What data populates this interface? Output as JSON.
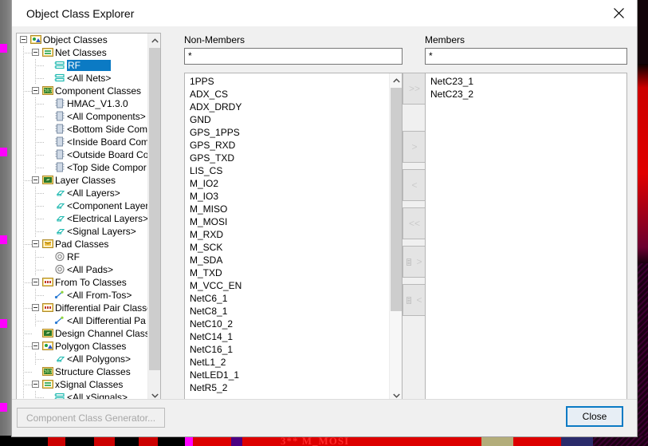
{
  "window": {
    "title": "Object Class Explorer",
    "close_icon": "close-icon"
  },
  "tree": {
    "items": [
      {
        "label": "Object Classes",
        "depth": 0,
        "icon": "object-classes-icon",
        "expander": "minus",
        "selected": false
      },
      {
        "label": "Net Classes",
        "depth": 1,
        "icon": "net-class-folder-icon",
        "expander": "minus",
        "selected": false
      },
      {
        "label": "RF",
        "depth": 2,
        "icon": "net-class-icon",
        "expander": "none",
        "selected": true
      },
      {
        "label": "<All Nets>",
        "depth": 2,
        "icon": "net-class-icon",
        "expander": "none",
        "selected": false
      },
      {
        "label": "Component Classes",
        "depth": 1,
        "icon": "component-folder-icon",
        "expander": "minus",
        "selected": false
      },
      {
        "label": "HMAC_V1.3.0",
        "depth": 2,
        "icon": "component-icon",
        "expander": "none",
        "selected": false
      },
      {
        "label": "<All Components>",
        "depth": 2,
        "icon": "component-icon",
        "expander": "none",
        "selected": false
      },
      {
        "label": "<Bottom Side Com",
        "depth": 2,
        "icon": "component-icon",
        "expander": "none",
        "selected": false
      },
      {
        "label": "<Inside Board Com",
        "depth": 2,
        "icon": "component-icon",
        "expander": "none",
        "selected": false
      },
      {
        "label": "<Outside Board Co",
        "depth": 2,
        "icon": "component-icon",
        "expander": "none",
        "selected": false
      },
      {
        "label": "<Top Side Compor",
        "depth": 2,
        "icon": "component-icon",
        "expander": "none",
        "selected": false
      },
      {
        "label": "Layer Classes",
        "depth": 1,
        "icon": "layer-folder-icon",
        "expander": "minus",
        "selected": false
      },
      {
        "label": "<All Layers>",
        "depth": 2,
        "icon": "layer-icon",
        "expander": "none",
        "selected": false
      },
      {
        "label": "<Component Layer",
        "depth": 2,
        "icon": "layer-icon",
        "expander": "none",
        "selected": false
      },
      {
        "label": "<Electrical Layers>",
        "depth": 2,
        "icon": "layer-icon",
        "expander": "none",
        "selected": false
      },
      {
        "label": "<Signal Layers>",
        "depth": 2,
        "icon": "layer-icon",
        "expander": "none",
        "selected": false
      },
      {
        "label": "Pad Classes",
        "depth": 1,
        "icon": "pad-folder-icon",
        "expander": "minus",
        "selected": false
      },
      {
        "label": "RF",
        "depth": 2,
        "icon": "pad-icon",
        "expander": "none",
        "selected": false
      },
      {
        "label": "<All Pads>",
        "depth": 2,
        "icon": "pad-icon",
        "expander": "none",
        "selected": false
      },
      {
        "label": "From To Classes",
        "depth": 1,
        "icon": "fromto-folder-icon",
        "expander": "minus",
        "selected": false
      },
      {
        "label": "<All From-Tos>",
        "depth": 2,
        "icon": "fromto-icon",
        "expander": "none",
        "selected": false
      },
      {
        "label": "Differential Pair Classe",
        "depth": 1,
        "icon": "diffpair-folder-icon",
        "expander": "minus",
        "selected": false
      },
      {
        "label": "<All Differential Pa",
        "depth": 2,
        "icon": "fromto-icon",
        "expander": "none",
        "selected": false
      },
      {
        "label": "Design Channel Class",
        "depth": 1,
        "icon": "layer-folder-icon",
        "expander": "none",
        "selected": false
      },
      {
        "label": "Polygon Classes",
        "depth": 1,
        "icon": "object-classes-icon",
        "expander": "minus",
        "selected": false
      },
      {
        "label": "<All Polygons>",
        "depth": 2,
        "icon": "layer-icon",
        "expander": "none",
        "selected": false
      },
      {
        "label": "Structure Classes",
        "depth": 1,
        "icon": "component-folder-icon",
        "expander": "none",
        "selected": false
      },
      {
        "label": "xSignal Classes",
        "depth": 1,
        "icon": "net-class-folder-icon",
        "expander": "minus",
        "selected": false
      },
      {
        "label": "<All xSignals>",
        "depth": 2,
        "icon": "net-class-icon",
        "expander": "none",
        "selected": false
      }
    ],
    "scrollbar": {
      "up_arrow_icon": "chevron-up-icon",
      "down_arrow_icon": "chevron-down-icon"
    }
  },
  "non_members": {
    "label": "Non-Members",
    "filter_value": "*",
    "filter_placeholder": "*",
    "items": [
      "1PPS",
      "ADX_CS",
      "ADX_DRDY",
      "GND",
      "GPS_1PPS",
      "GPS_RXD",
      "GPS_TXD",
      "LIS_CS",
      "M_IO2",
      "M_IO3",
      "M_MISO",
      "M_MOSI",
      "M_RXD",
      "M_SCK",
      "M_SDA",
      "M_TXD",
      "M_VCC_EN",
      "NetC6_1",
      "NetC8_1",
      "NetC10_2",
      "NetC14_1",
      "NetC16_1",
      "NetL1_2",
      "NetLED1_1",
      "NetR5_2"
    ],
    "scrollbar": {
      "up_arrow_icon": "chevron-up-icon",
      "down_arrow_icon": "chevron-down-icon"
    }
  },
  "members": {
    "label": "Members",
    "filter_value": "*",
    "filter_placeholder": "*",
    "items": [
      "NetC23_1",
      "NetC23_2"
    ]
  },
  "transfer_buttons": [
    {
      "label": ">>",
      "name": "move-all-right-button",
      "icon": "double-chevron-right-icon"
    },
    {
      "label": ">",
      "name": "move-right-button",
      "icon": "chevron-right-icon"
    },
    {
      "label": "<",
      "name": "move-left-button",
      "icon": "chevron-left-icon"
    },
    {
      "label": "<<",
      "name": "move-all-left-button",
      "icon": "double-chevron-left-icon"
    },
    {
      "label": ">",
      "name": "move-list-right-button",
      "icon": "list-chevron-right-icon"
    },
    {
      "label": "<",
      "name": "move-list-left-button",
      "icon": "list-chevron-left-icon"
    }
  ],
  "footer": {
    "generator_label": "Component Class Generator...",
    "close_label": "Close"
  },
  "backdrop": {
    "bottom_text": "3** M_MOSI"
  },
  "colors": {
    "selection": "#0b7ac4",
    "accent": "#0b7ac4",
    "dialog_bg": "#f0f0f0",
    "list_bg": "#ffffff"
  }
}
